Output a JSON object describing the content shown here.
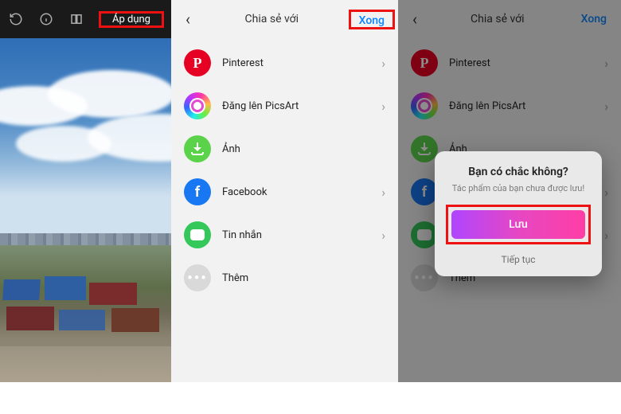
{
  "editor": {
    "apply_label": "Áp dụng"
  },
  "share": {
    "title": "Chia sẻ với",
    "done": "Xong",
    "items": [
      {
        "label": "Pinterest"
      },
      {
        "label": "Đăng lên PicsArt"
      },
      {
        "label": "Ảnh"
      },
      {
        "label": "Facebook"
      },
      {
        "label": "Tin nhắn"
      },
      {
        "label": "Thêm"
      }
    ]
  },
  "dialog": {
    "title": "Bạn có chắc không?",
    "subtitle": "Tác phẩm của bạn chưa được lưu!",
    "save": "Lưu",
    "continue": "Tiếp tục"
  }
}
